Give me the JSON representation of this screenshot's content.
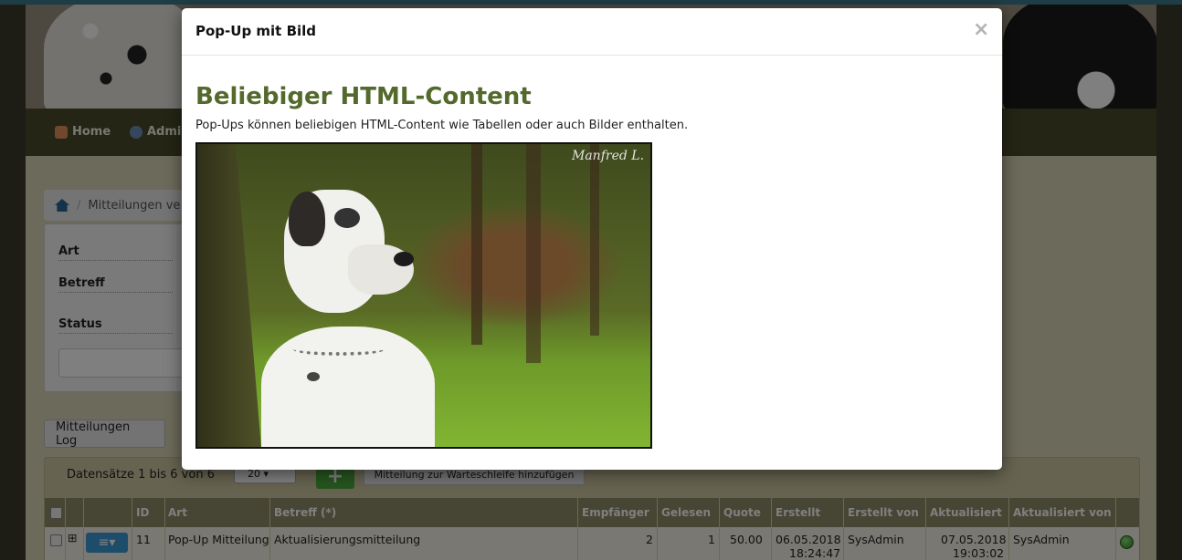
{
  "nav": {
    "items": [
      {
        "label": "Home"
      },
      {
        "label": "Admin"
      }
    ]
  },
  "breadcrumb": {
    "current": "Mitteilungen ve"
  },
  "filter": {
    "labels": [
      "Art",
      "Betreff",
      "Status"
    ]
  },
  "log_button": "Mitteilungen Log",
  "grid": {
    "records_text": "Datensätze 1 bis 6 von 6",
    "page_size": "20",
    "add_label": "+",
    "queue_button": "Mitteilung zur Warteschleife hinzufügen",
    "headers": [
      "ID",
      "Art",
      "Betreff (*)",
      "Empfänger",
      "Gelesen",
      "Quote",
      "Erstellt",
      "Erstellt von",
      "Aktualisiert",
      "Aktualisiert von"
    ],
    "row": {
      "expand": "⊞",
      "menu": "≡▾",
      "id": "11",
      "art": "Pop-Up Mitteilung",
      "betreff": "Aktualisierungsmitteilung",
      "empfaenger": "2",
      "gelesen": "1",
      "quote": "50.00",
      "erstellt_date": "06.05.2018",
      "erstellt_time": "18:24:47",
      "erstellt_von": "SysAdmin",
      "aktualisiert_date": "07.05.2018",
      "aktualisiert_time": "19:03:02",
      "aktualisiert_von": "SysAdmin"
    }
  },
  "modal": {
    "title": "Pop-Up mit Bild",
    "close": "×",
    "heading": "Beliebiger HTML-Content",
    "text": "Pop-Ups können beliebigen HTML-Content wie Tabellen oder auch Bilder enthalten.",
    "photo_signature": "Manfred L."
  },
  "colors": {
    "heading_green": "#546a2c",
    "nav_bar": "#4a4a2c",
    "header_row": "#8f8a67",
    "add_green": "#4caa3c",
    "menu_blue": "#3a9ad4"
  }
}
